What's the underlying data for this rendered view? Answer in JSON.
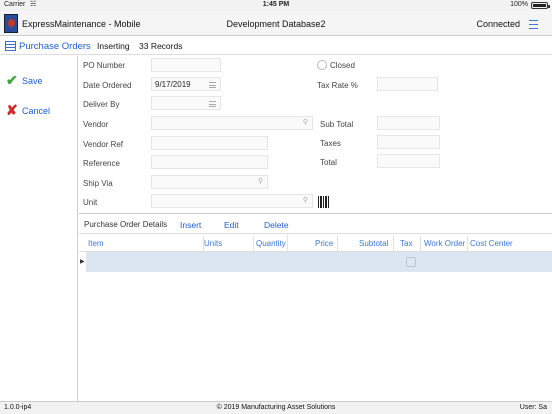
{
  "status_bar": {
    "carrier": "Carrier",
    "time": "1:45 PM",
    "battery": "100%"
  },
  "title_bar": {
    "app_title": "ExpressMaintenance - Mobile",
    "database": "Development Database2",
    "connection": "Connected"
  },
  "form_bar": {
    "title": "Purchase Orders",
    "mode": "Inserting",
    "records": "33 Records"
  },
  "sidebar": {
    "save": "Save",
    "cancel": "Cancel"
  },
  "form": {
    "po_number_label": "PO Number",
    "date_ordered_label": "Date Ordered",
    "date_ordered_value": "9/17/2019",
    "deliver_by_label": "Deliver By",
    "vendor_label": "Vendor",
    "vendor_ref_label": "Vendor Ref",
    "reference_label": "Reference",
    "ship_via_label": "Ship Via",
    "unit_label": "Unit",
    "closed_label": "Closed",
    "tax_rate_label": "Tax Rate %",
    "sub_total_label": "Sub Total",
    "taxes_label": "Taxes",
    "total_label": "Total"
  },
  "details": {
    "title": "Purchase Order Details",
    "insert": "Insert",
    "edit": "Edit",
    "delete": "Delete",
    "columns": [
      "Item",
      "Units",
      "Quantity",
      "Price",
      "Subtotal",
      "Tax",
      "Work Order",
      "Cost Center"
    ]
  },
  "footer": {
    "version": "1.0.0-ip4",
    "copyright": "© 2019 Manufacturing Asset Solutions",
    "user": "User: Sa"
  }
}
